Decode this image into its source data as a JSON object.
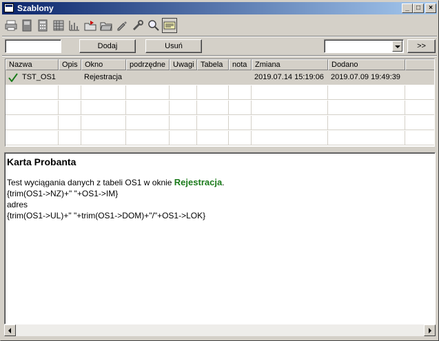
{
  "window": {
    "title": "Szablony"
  },
  "titlebar_buttons": {
    "minimize": "_",
    "maximize": "□",
    "close": "×"
  },
  "toolbar": {
    "tools": [
      "print-icon",
      "print-preview-icon",
      "calculator-icon",
      "table-icon",
      "chart-icon",
      "export-folder-icon",
      "open-folder-icon",
      "edit-icon",
      "tools-icon",
      "magnifier-icon",
      "card-icon"
    ]
  },
  "actions": {
    "filter_value": "",
    "add_label": "Dodaj",
    "remove_label": "Usuń",
    "combo_value": "",
    "next_label": ">>"
  },
  "table": {
    "columns": [
      "Nazwa",
      "Opis",
      "Okno",
      "podrzędne",
      "Uwagi",
      "Tabela",
      "nota",
      "Zmiana",
      "Dodano"
    ],
    "rows": [
      {
        "nazwa": "TST_OS1",
        "opis": "",
        "okno": "Rejestracja",
        "podrzedne": "",
        "uwagi": "",
        "tabela": "",
        "nota": "",
        "zmiana": "2019.07.14 15:19:06",
        "dodano": "2019.07.09 19:49:39"
      }
    ]
  },
  "preview": {
    "title": "Karta Probanta",
    "line1_prefix": "Test wyciągania danych z tabeli OS1 w oknie ",
    "line1_strong": "Rejestracja",
    "line1_suffix": ".",
    "line2": "{trim(OS1->NZ)+\" \"+OS1->IM}",
    "line3": "adres",
    "line4": "{trim(OS1->UL)+\" \"+trim(OS1->DOM)+\"/\"+OS1->LOK}"
  },
  "colors": {
    "titlebar": "#0a246a",
    "highlight_text": "#1a7a1a",
    "check": "#1a7a1a"
  }
}
